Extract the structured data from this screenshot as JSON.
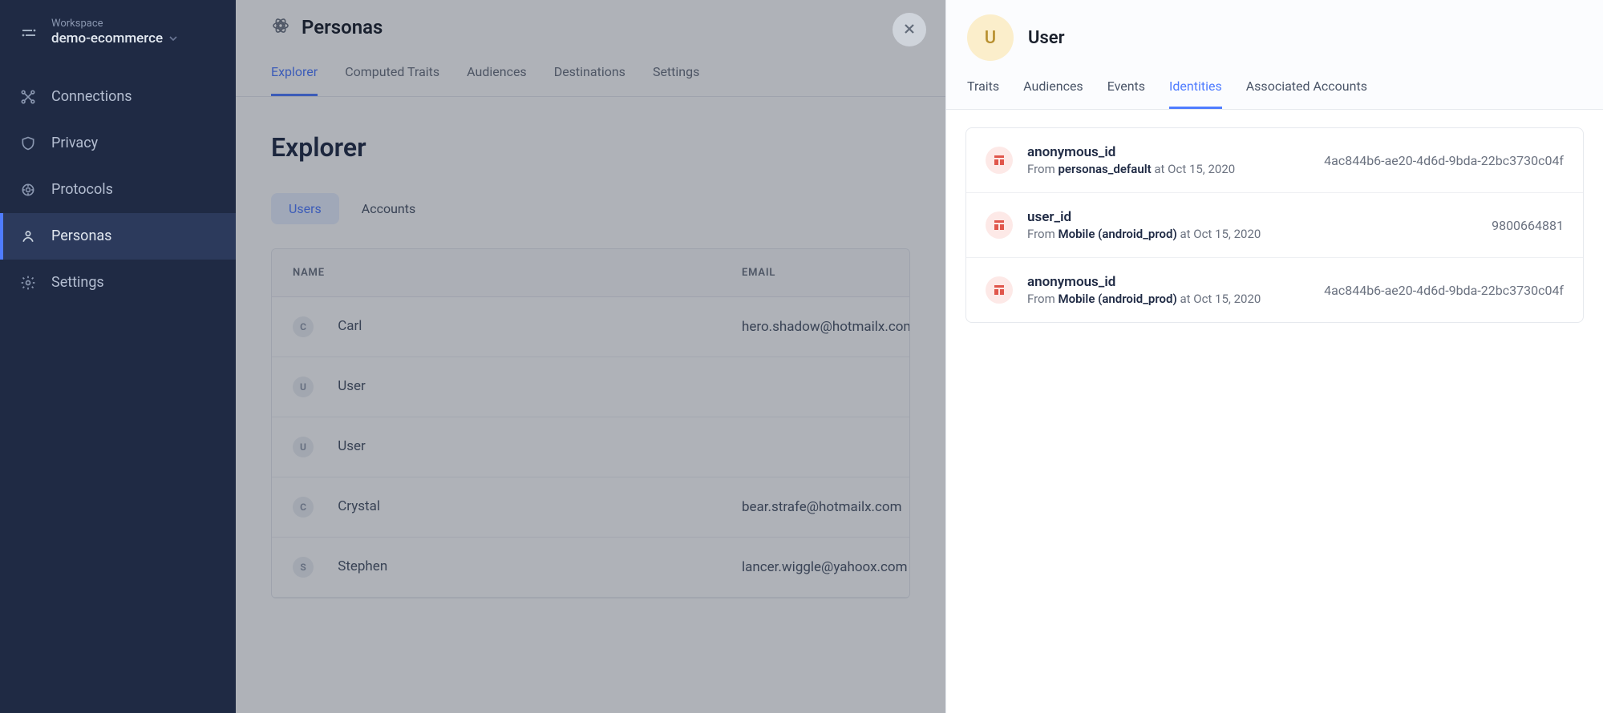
{
  "workspace": {
    "label": "Workspace",
    "name": "demo-ecommerce"
  },
  "nav": {
    "items": [
      {
        "key": "connections",
        "label": "Connections"
      },
      {
        "key": "privacy",
        "label": "Privacy"
      },
      {
        "key": "protocols",
        "label": "Protocols"
      },
      {
        "key": "personas",
        "label": "Personas"
      },
      {
        "key": "settings",
        "label": "Settings"
      }
    ],
    "active": "personas"
  },
  "page": {
    "title": "Personas",
    "tabs": [
      {
        "label": "Explorer",
        "active": true
      },
      {
        "label": "Computed Traits"
      },
      {
        "label": "Audiences"
      },
      {
        "label": "Destinations"
      },
      {
        "label": "Settings"
      }
    ],
    "section": "Explorer",
    "pills": [
      {
        "label": "Users",
        "active": true
      },
      {
        "label": "Accounts"
      }
    ],
    "columns": {
      "name": "NAME",
      "email": "EMAIL"
    },
    "rows": [
      {
        "initial": "C",
        "name": "Carl",
        "email": "hero.shadow@hotmailx.com"
      },
      {
        "initial": "U",
        "name": "User",
        "email": ""
      },
      {
        "initial": "U",
        "name": "User",
        "email": ""
      },
      {
        "initial": "C",
        "name": "Crystal",
        "email": "bear.strafe@hotmailx.com"
      },
      {
        "initial": "S",
        "name": "Stephen",
        "email": "lancer.wiggle@yahoox.com"
      }
    ]
  },
  "drawer": {
    "avatar": "U",
    "title": "User",
    "tabs": [
      {
        "label": "Traits"
      },
      {
        "label": "Audiences"
      },
      {
        "label": "Events"
      },
      {
        "label": "Identities",
        "active": true
      },
      {
        "label": "Associated Accounts"
      }
    ],
    "identities": [
      {
        "key": "anonymous_id",
        "from_prefix": "From ",
        "source": "personas_default",
        "at": " at Oct 15, 2020",
        "value": "4ac844b6-ae20-4d6d-9bda-22bc3730c04f"
      },
      {
        "key": "user_id",
        "from_prefix": "From ",
        "source": "Mobile (android_prod)",
        "at": " at Oct 15, 2020",
        "value": "9800664881"
      },
      {
        "key": "anonymous_id",
        "from_prefix": "From ",
        "source": "Mobile (android_prod)",
        "at": " at Oct 15, 2020",
        "value": "4ac844b6-ae20-4d6d-9bda-22bc3730c04f"
      }
    ]
  }
}
